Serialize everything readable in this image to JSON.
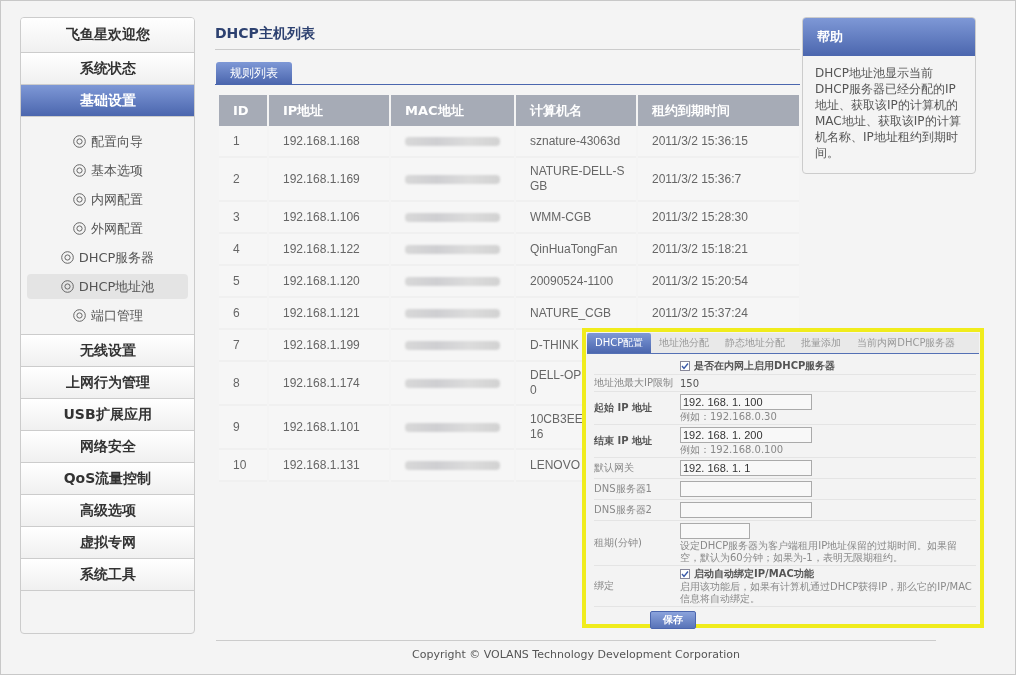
{
  "sidebar": {
    "items": [
      {
        "label": "飞鱼星欢迎您",
        "selected": false
      },
      {
        "label": "系统状态",
        "selected": false
      },
      {
        "label": "基础设置",
        "selected": true,
        "children": [
          {
            "label": "配置向导",
            "selected": false
          },
          {
            "label": "基本选项",
            "selected": false
          },
          {
            "label": "内网配置",
            "selected": false
          },
          {
            "label": "外网配置",
            "selected": false
          },
          {
            "label": "DHCP服务器",
            "selected": false
          },
          {
            "label": "DHCP地址池",
            "selected": true
          },
          {
            "label": "端口管理",
            "selected": false
          }
        ]
      },
      {
        "label": "无线设置",
        "selected": false
      },
      {
        "label": "上网行为管理",
        "selected": false
      },
      {
        "label": "USB扩展应用",
        "selected": false
      },
      {
        "label": "网络安全",
        "selected": false
      },
      {
        "label": "QoS流量控制",
        "selected": false
      },
      {
        "label": "高级选项",
        "selected": false
      },
      {
        "label": "虚拟专网",
        "selected": false
      },
      {
        "label": "系统工具",
        "selected": false
      }
    ]
  },
  "main": {
    "title": "DHCP主机列表",
    "tabs": [
      {
        "label": "规则列表",
        "selected": true
      }
    ],
    "table": {
      "columns": [
        "ID",
        "IP地址",
        "MAC地址",
        "计算机名",
        "租约到期时间"
      ],
      "rows": [
        {
          "id": "1",
          "ip": "192.168.1.168",
          "computer_name": "sznature-43063d",
          "lease_expiry": "2011/3/2 15:36:15"
        },
        {
          "id": "2",
          "ip": "192.168.1.169",
          "computer_name": "NATURE-DELL-S\nGB",
          "lease_expiry": "2011/3/2 15:36:7"
        },
        {
          "id": "3",
          "ip": "192.168.1.106",
          "computer_name": "WMM-CGB",
          "lease_expiry": "2011/3/2 15:28:30"
        },
        {
          "id": "4",
          "ip": "192.168.1.122",
          "computer_name": "QinHuaTongFan",
          "lease_expiry": "2011/3/2 15:18:21"
        },
        {
          "id": "5",
          "ip": "192.168.1.120",
          "computer_name": "20090524-1100",
          "lease_expiry": "2011/3/2 15:20:54"
        },
        {
          "id": "6",
          "ip": "192.168.1.121",
          "computer_name": "NATURE_CGB",
          "lease_expiry": "2011/3/2 15:37:24"
        },
        {
          "id": "7",
          "ip": "192.168.1.199",
          "computer_name": "D-THINK"
        },
        {
          "id": "8",
          "ip": "192.168.1.174",
          "computer_name": "DELL-OP\n0"
        },
        {
          "id": "9",
          "ip": "192.168.1.101",
          "computer_name": "10CB3EE\n16"
        },
        {
          "id": "10",
          "ip": "192.168.1.131",
          "computer_name": "LENOVO"
        }
      ]
    }
  },
  "help": {
    "title": "帮助",
    "text": "DHCP地址池显示当前DHCP服务器已经分配的IP地址、获取该IP的计算机的MAC地址、获取该IP的计算机名称、IP地址租约到期时间。"
  },
  "dhcp_panel": {
    "tabs": [
      {
        "label": "DHCP配置",
        "selected": true
      },
      {
        "label": "地址池分配",
        "selected": false
      },
      {
        "label": "静态地址分配",
        "selected": false
      },
      {
        "label": "批量添加",
        "selected": false
      },
      {
        "label": "当前内网DHCP服务器",
        "selected": false
      }
    ],
    "fields": [
      {
        "kind": "checkbox",
        "option": "是否在内网上启用DHCP服务器",
        "checked": true
      },
      {
        "kind": "static",
        "label": "地址池最大IP限制",
        "value": "150",
        "emphasized": false
      },
      {
        "kind": "input",
        "label": "起始 IP 地址",
        "value": "192. 168. 1. 100",
        "hint": "例如：192.168.0.30",
        "emphasized": true
      },
      {
        "kind": "input",
        "label": "结束 IP 地址",
        "value": "192. 168. 1. 200",
        "hint": "例如：192.168.0.100",
        "emphasized": true
      },
      {
        "kind": "input",
        "label": "默认网关",
        "value": "192. 168. 1. 1",
        "emphasized": false
      },
      {
        "kind": "input",
        "label": "DNS服务器1",
        "emphasized": false
      },
      {
        "kind": "input",
        "label": "DNS服务器2",
        "emphasized": false
      },
      {
        "kind": "short_input",
        "label": "租期(分钟)",
        "hint": "设定DHCP服务器为客户端租用IP地址保留的过期时间。如果留空，默认为60分钟；如果为-1，表明无限期租约。",
        "emphasized": false
      },
      {
        "kind": "checkbox",
        "label": "绑定",
        "option": "启动自动绑定IP/MAC功能",
        "checked": true,
        "hint": "启用该功能后，如果有计算机通过DHCP获得IP，那么它的IP/MAC信息将自动绑定。",
        "emphasized": false
      }
    ],
    "save_button": "保存"
  },
  "footer": "Copyright © VOLANS Technology Development Corporation"
}
